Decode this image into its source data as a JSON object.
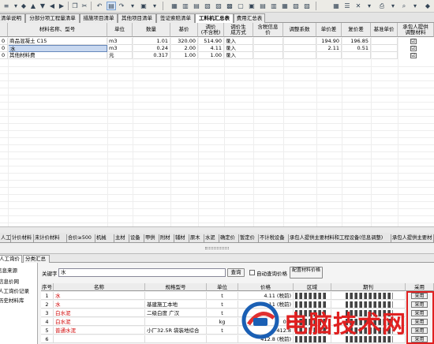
{
  "tabs": [
    "清单说明",
    "分部分项工程量清单",
    "措施项目清单",
    "其他项目清单",
    "签证索赔清单",
    "工料机汇总表",
    "费用汇总表"
  ],
  "active_tab": 5,
  "main_headers": [
    "材料名称、型号",
    "单位",
    "数量",
    "基价",
    "调价\n(不含税)",
    "调价生\n成方式",
    "含税信息\n价",
    "调整系数",
    "单价差",
    "复价差",
    "基准单价",
    "承包人提供\n调整材料"
  ],
  "main_rows": [
    {
      "id": "0",
      "name": "商品混凝土 C15",
      "unit": "m3",
      "qty": "1.01",
      "base": "320.00",
      "adj": "514.90",
      "mode": "录入",
      "info": "",
      "coef": "",
      "diff": "194.90",
      "tdiff": "196.85",
      "bench": "",
      "check": "☑"
    },
    {
      "id": "0",
      "name": "水",
      "unit": "m3",
      "qty": "0.24",
      "base": "2.00",
      "adj": "4.11",
      "mode": "录入",
      "info": "",
      "coef": "",
      "diff": "2.11",
      "tdiff": "0.51",
      "bench": "",
      "check": "☑"
    },
    {
      "id": "0",
      "name": "其他材料费",
      "unit": "元",
      "qty": "0.317",
      "base": "1.00",
      "adj": "1.00",
      "mode": "录入",
      "info": "",
      "coef": "",
      "diff": "",
      "tdiff": "",
      "bench": "",
      "check": "☑"
    }
  ],
  "categories": [
    "人工",
    "计价材料",
    "未计价材料",
    "合价≥500",
    "机械",
    "主材",
    "设备",
    "甲供",
    "附材",
    "辅材",
    "原木",
    "水泥",
    "确定价",
    "暂定价",
    "不计税设备",
    "承包人提供主要材料和工程设备(信息调整)",
    "承包人提供主要材"
  ],
  "lower_tabs": [
    "人工询价",
    "分类汇总"
  ],
  "left_panel": [
    "信息来源",
    "信息价网",
    "人工询价记录",
    "历史材料库"
  ],
  "search": {
    "label": "关键字",
    "value": "水",
    "query_btn": "查询",
    "auto_label": "自动查询价格",
    "match_btn": "配置材料价格"
  },
  "lower_headers": [
    "序号",
    "名称",
    "规格型号",
    "单位",
    "价格",
    "区域",
    "期刊",
    "采用"
  ],
  "lower_rows": [
    {
      "no": "1",
      "name": "水",
      "spec": "",
      "unit": "t",
      "price": "4.11 (税前)"
    },
    {
      "no": "2",
      "name": "水",
      "spec": "基建施工本地",
      "unit": "t",
      "price": "4.11 (税前)"
    },
    {
      "no": "3",
      "name": "白水泥",
      "spec": "二级白度 广汉",
      "unit": "t",
      "price": ""
    },
    {
      "no": "4",
      "name": "白水泥",
      "spec": "",
      "unit": "kg",
      "price": "0.8"
    },
    {
      "no": "5",
      "name": "普通水泥",
      "spec": "小厂32.5R 袋装地综合",
      "unit": "t",
      "price": "412.8"
    },
    {
      "no": "6",
      "name": "",
      "spec": "",
      "unit": "",
      "price": "412.8 (税前)"
    }
  ],
  "adopt_label": "采用",
  "watermark": "电脑技术网",
  "colors": {
    "accent": "#d00000",
    "selection": "#c8d8f0",
    "active_tab": "#ffffff"
  },
  "chart_data": {
    "type": "table",
    "columns": [
      "材料名称、型号",
      "单位",
      "数量",
      "基价",
      "调价(不含税)",
      "调价生成方式",
      "单价差",
      "复价差"
    ],
    "rows": [
      [
        "商品混凝土 C15",
        "m3",
        1.01,
        320.0,
        514.9,
        "录入",
        194.9,
        196.85
      ],
      [
        "水",
        "m3",
        0.24,
        2.0,
        4.11,
        "录入",
        2.11,
        0.51
      ],
      [
        "其他材料费",
        "元",
        0.317,
        1.0,
        1.0,
        "录入",
        null,
        null
      ]
    ]
  }
}
